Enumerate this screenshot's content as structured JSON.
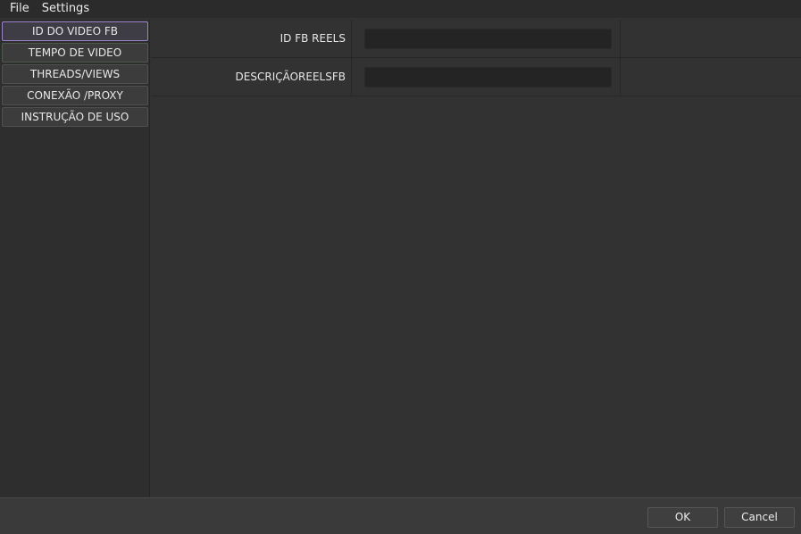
{
  "menubar": {
    "items": [
      {
        "label": "File"
      },
      {
        "label": "Settings"
      }
    ]
  },
  "sidebar": {
    "items": [
      {
        "label": "ID DO VIDEO FB",
        "active": true
      },
      {
        "label": "TEMPO DE VIDEO"
      },
      {
        "label": "THREADS/VIEWS"
      },
      {
        "label": "CONEXÃO /PROXY"
      },
      {
        "label": "INSTRUÇÃO DE USO"
      }
    ]
  },
  "form": {
    "rows": [
      {
        "label": "ID FB REELS",
        "value": "",
        "placeholder": ""
      },
      {
        "label": "DESCRIÇÃOREELSFB",
        "value": "",
        "placeholder": ""
      }
    ]
  },
  "footer": {
    "ok_label": "OK",
    "cancel_label": "Cancel"
  },
  "colors": {
    "background": "#323232",
    "accent_active": "#9a82c8"
  }
}
